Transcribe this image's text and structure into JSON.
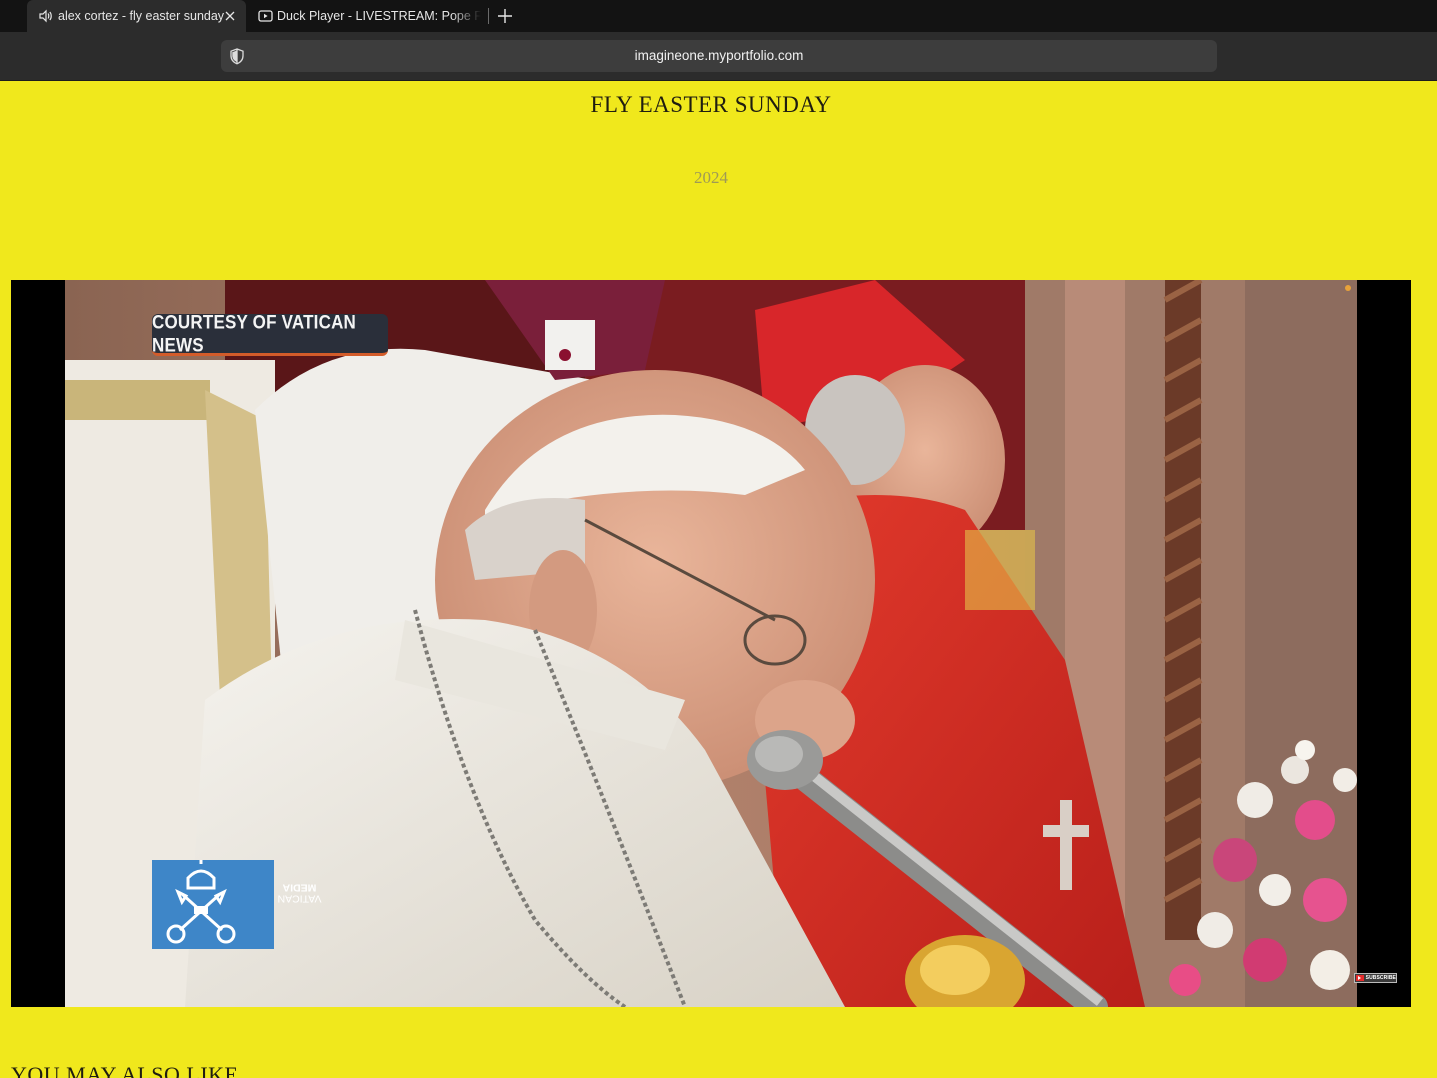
{
  "browser": {
    "tabs": [
      {
        "title": "alex cortez - fly easter sunday",
        "icon": "speaker-icon",
        "active": true
      },
      {
        "title": "Duck Player - LIVESTREAM: Pope Francis",
        "icon": "duck-player-icon",
        "active": false
      }
    ],
    "address": "imagineone.myportfolio.com"
  },
  "page": {
    "title": "FLY EASTER SUNDAY",
    "year": "2024",
    "section_heading": "YOU MAY ALSO LIKE"
  },
  "video": {
    "overlay_badge": "COURTESY OF VATICAN NEWS",
    "logo_line1": "VATICAN",
    "logo_line2": "MEDIA",
    "subscribe_label": "SUBSCRIBE"
  },
  "colors": {
    "page_background": "#f0e81c",
    "tabbar_background": "#131313",
    "toolbar_background": "#2c2c2c"
  }
}
